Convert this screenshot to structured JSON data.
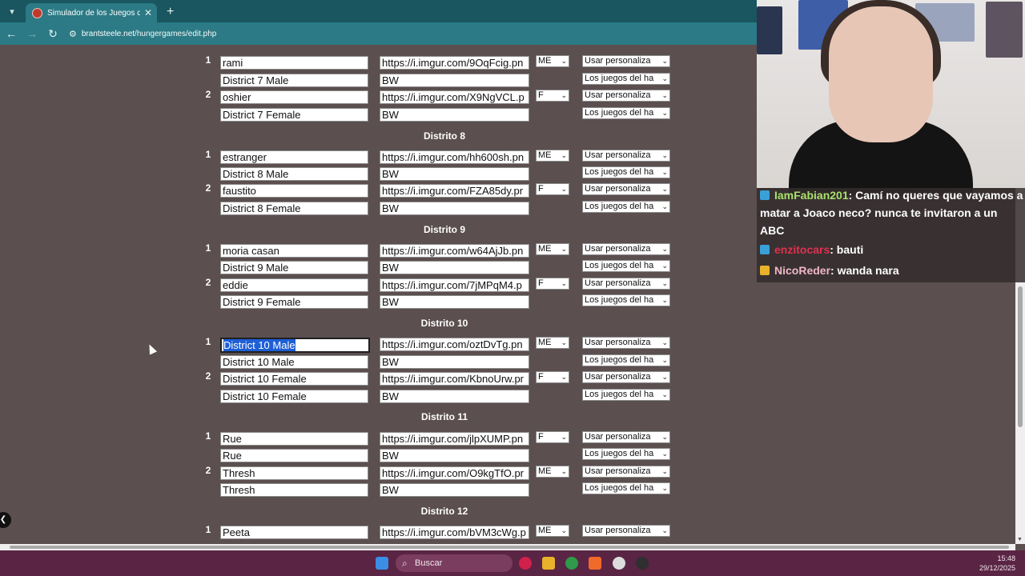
{
  "browser": {
    "tab_title": "Simulador de los Juegos del Ha",
    "url_host": "brantsteele.net",
    "url_path": "/hungergames/edit.php"
  },
  "page": {
    "rows": [
      {
        "num": "1",
        "name": "rami",
        "url": "https://i.imgur.com/9OqFcig.pn",
        "gender": "ME",
        "drop": "Usar personaliza"
      },
      {
        "num": "",
        "name": "District 7 Male",
        "url": "BW",
        "gender": "",
        "drop": "Los juegos del ha"
      },
      {
        "num": "2",
        "name": "oshier",
        "url": "https://i.imgur.com/X9NgVCL.p",
        "gender": "F",
        "drop": "Usar personaliza"
      },
      {
        "num": "",
        "name": "District 7 Female",
        "url": "BW",
        "gender": "",
        "drop": "Los juegos del ha"
      },
      {
        "num": "1",
        "name": "estranger",
        "url": "https://i.imgur.com/hh600sh.pn",
        "gender": "ME",
        "drop": "Usar personaliza"
      },
      {
        "num": "",
        "name": "District 8 Male",
        "url": "BW",
        "gender": "",
        "drop": "Los juegos del ha"
      },
      {
        "num": "2",
        "name": "faustito",
        "url": "https://i.imgur.com/FZA85dy.pr",
        "gender": "F",
        "drop": "Usar personaliza"
      },
      {
        "num": "",
        "name": "District 8 Female",
        "url": "BW",
        "gender": "",
        "drop": "Los juegos del ha"
      },
      {
        "num": "1",
        "name": "moria casan",
        "url": "https://i.imgur.com/w64AjJb.pn",
        "gender": "ME",
        "drop": "Usar personaliza"
      },
      {
        "num": "",
        "name": "District 9 Male",
        "url": "BW",
        "gender": "",
        "drop": "Los juegos del ha"
      },
      {
        "num": "2",
        "name": "eddie",
        "url": "https://i.imgur.com/7jMPqM4.p",
        "gender": "F",
        "drop": "Usar personaliza"
      },
      {
        "num": "",
        "name": "District 9 Female",
        "url": "BW",
        "gender": "",
        "drop": "Los juegos del ha"
      },
      {
        "num": "1",
        "name": "District 10 Male",
        "url": "https://i.imgur.com/oztDvTg.pn",
        "gender": "ME",
        "drop": "Usar personaliza"
      },
      {
        "num": "",
        "name": "District 10 Male",
        "url": "BW",
        "gender": "",
        "drop": "Los juegos del ha"
      },
      {
        "num": "2",
        "name": "District 10 Female",
        "url": "https://i.imgur.com/KbnoUrw.pr",
        "gender": "F",
        "drop": "Usar personaliza"
      },
      {
        "num": "",
        "name": "District 10 Female",
        "url": "BW",
        "gender": "",
        "drop": "Los juegos del ha"
      },
      {
        "num": "1",
        "name": "Rue",
        "url": "https://i.imgur.com/jlpXUMP.pn",
        "gender": "F",
        "drop": "Usar personaliza"
      },
      {
        "num": "",
        "name": "Rue",
        "url": "BW",
        "gender": "",
        "drop": "Los juegos del ha"
      },
      {
        "num": "2",
        "name": "Thresh",
        "url": "https://i.imgur.com/O9kgTfO.pr",
        "gender": "ME",
        "drop": "Usar personaliza"
      },
      {
        "num": "",
        "name": "Thresh",
        "url": "BW",
        "gender": "",
        "drop": "Los juegos del ha"
      },
      {
        "num": "1",
        "name": "Peeta",
        "url": "https://i.imgur.com/bVM3cWg.p",
        "gender": "ME",
        "drop": "Usar personaliza"
      }
    ],
    "districts": [
      "Distrito 8",
      "Distrito 9",
      "Distrito 10",
      "Distrito 11",
      "Distrito 12"
    ]
  },
  "chat": [
    {
      "user": "IamFabian201",
      "text": ": Camí no queres que vayamos a matar a Joaco neco? nunca te invitaron a un ABC",
      "user_color": "#a8e06b",
      "badge_color": "#3aa0d8"
    },
    {
      "user": "enzitocars",
      "text": ": bauti",
      "user_color": "#e0314f",
      "badge_color": "#3aa0d8"
    },
    {
      "user": "NicoReder",
      "text": ": wanda nara",
      "user_color": "#f0b7c8",
      "badge_color": "#e8b22a"
    }
  ],
  "taskbar": {
    "search_label": "Buscar",
    "time": "15:48",
    "date": "29/12/2025"
  },
  "colors": {
    "page_bg": "#5b4f4f",
    "chrome_dark": "#19565f",
    "chrome": "#2b7a85",
    "taskbar": "#5a2444",
    "selection": "#1e5fd6"
  }
}
